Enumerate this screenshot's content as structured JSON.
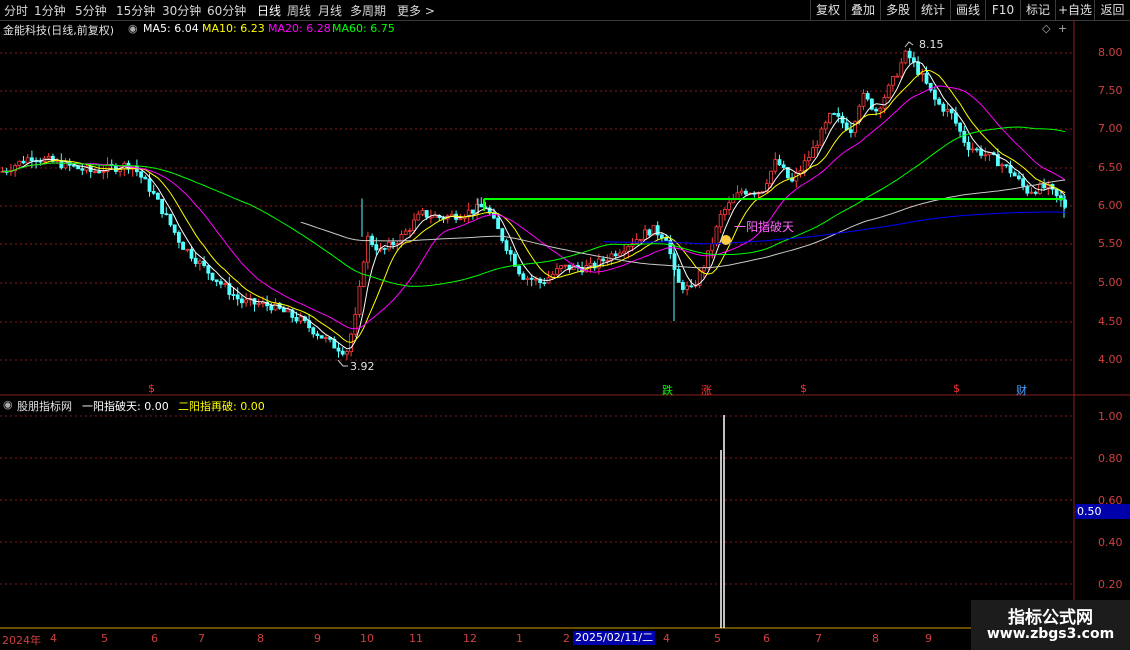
{
  "toolbar": {
    "periods": [
      "分时",
      "1分钟",
      "5分钟",
      "15分钟",
      "30分钟",
      "60分钟",
      "日线",
      "周线",
      "月线",
      "多周期",
      "更多 >"
    ],
    "active_period": "日线",
    "right_buttons": [
      "复权",
      "叠加",
      "多股",
      "统计",
      "画线",
      "F10",
      "标记",
      "+自选",
      "返回"
    ]
  },
  "main_panel": {
    "title": "金能科技(日线,前复权)",
    "ma_legend": [
      {
        "label": "MA5: 6.04",
        "color": "#ffffff"
      },
      {
        "label": "MA10: 6.23",
        "color": "#ffff00"
      },
      {
        "label": "MA20: 6.28",
        "color": "#ff00ff"
      },
      {
        "label": "MA60: 6.75",
        "color": "#00ff00"
      }
    ],
    "price_axis": [
      "8.00",
      "7.50",
      "7.00",
      "6.50",
      "6.00",
      "5.50",
      "5.00",
      "4.50",
      "4.00"
    ],
    "high_label": "8.15",
    "low_label": "3.92",
    "signal_label": "一阳指破天",
    "event_markers": [
      {
        "text": "$",
        "color": "#ff3030"
      },
      {
        "text": "跌",
        "color": "#00ff00"
      },
      {
        "text": "涨",
        "color": "#ff3030"
      },
      {
        "text": "$",
        "color": "#ff3030"
      },
      {
        "text": "$",
        "color": "#ff3030"
      },
      {
        "text": "财",
        "color": "#4aa0ff"
      }
    ]
  },
  "sub_panel": {
    "title": "股朋指标网",
    "legend": [
      {
        "label": "一阳指破天: 0.00",
        "color": "#ffffff"
      },
      {
        "label": "二阳指再破: 0.00",
        "color": "#ffff00"
      }
    ],
    "axis": [
      "1.00",
      "0.80",
      "0.60",
      "0.40",
      "0.20"
    ],
    "current_value": "0.50"
  },
  "date_axis": {
    "labels": [
      "2024年",
      "4",
      "5",
      "6",
      "7",
      "8",
      "9",
      "10",
      "11",
      "12",
      "1",
      "2",
      "4",
      "5",
      "6",
      "7",
      "8",
      "9"
    ],
    "cursor_date": "2025/02/11/二"
  },
  "watermark": {
    "line1": "指标公式网",
    "line2": "www.zbgs3.com"
  },
  "colors": {
    "up": "#ff3c3c",
    "down": "#54ffff",
    "ma5": "#ffffff",
    "ma10": "#ffff00",
    "ma20": "#ff00ff",
    "ma60": "#00ff00",
    "ma_long": "#0000ff",
    "ma_mid": "#c8c8c8"
  }
}
